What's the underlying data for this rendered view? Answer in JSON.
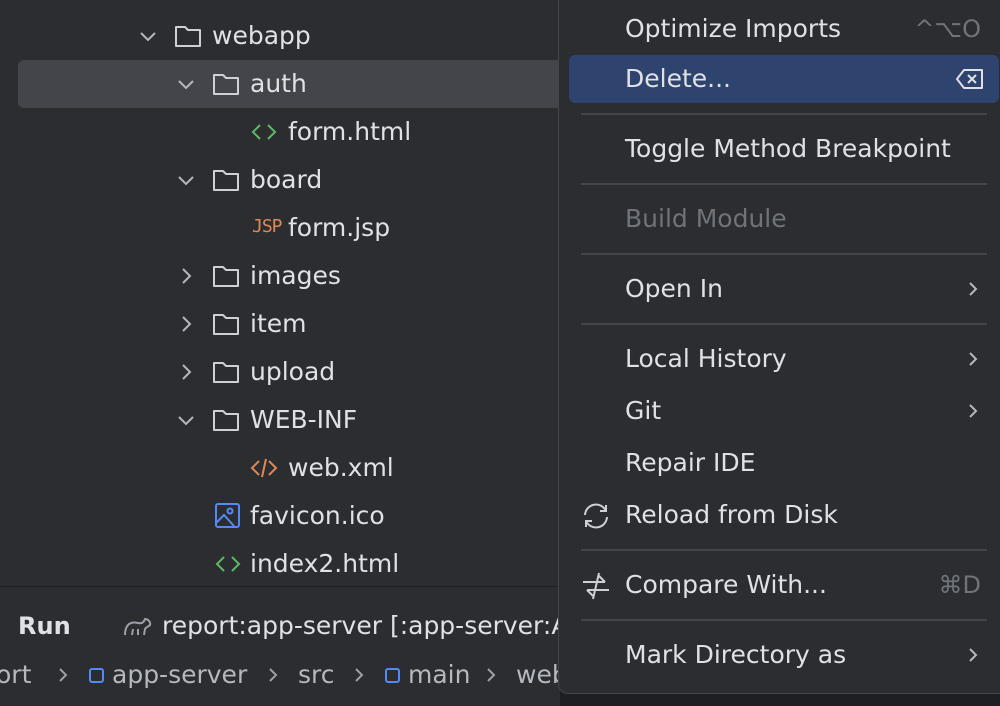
{
  "project_tree": {
    "items": [
      {
        "label": "webapp",
        "kind": "folder",
        "expanded": true
      },
      {
        "label": "auth",
        "kind": "folder",
        "expanded": true,
        "selected": true
      },
      {
        "label": "form.html",
        "kind": "html"
      },
      {
        "label": "board",
        "kind": "folder",
        "expanded": true
      },
      {
        "label": "form.jsp",
        "kind": "jsp",
        "badge": "JSP"
      },
      {
        "label": "images",
        "kind": "folder",
        "expanded": false
      },
      {
        "label": "item",
        "kind": "folder",
        "expanded": false
      },
      {
        "label": "upload",
        "kind": "folder",
        "expanded": false
      },
      {
        "label": "WEB-INF",
        "kind": "folder",
        "expanded": true
      },
      {
        "label": "web.xml",
        "kind": "xml"
      },
      {
        "label": "favicon.ico",
        "kind": "image"
      },
      {
        "label": "index2.html",
        "kind": "html"
      }
    ]
  },
  "run_panel": {
    "label": "Run",
    "config": "report:app-server [:app-server:A"
  },
  "breadcrumb": {
    "items": [
      "ort",
      "app-server",
      "src",
      "main",
      "web"
    ]
  },
  "context_menu": {
    "items": [
      {
        "label": "Optimize Imports",
        "shortcut": "^⌥O"
      },
      {
        "label": "Delete...",
        "icon": "delete-key-icon",
        "active": true
      },
      {
        "label": "Toggle Method Breakpoint"
      },
      {
        "label": "Build Module",
        "disabled": true
      },
      {
        "label": "Open In",
        "submenu": true
      },
      {
        "label": "Local History",
        "submenu": true
      },
      {
        "label": "Git",
        "submenu": true
      },
      {
        "label": "Repair IDE"
      },
      {
        "label": "Reload from Disk",
        "icon": "reload-icon"
      },
      {
        "label": "Compare With...",
        "icon": "compare-icon",
        "shortcut": "⌘D"
      },
      {
        "label": "Mark Directory as",
        "submenu": true
      }
    ]
  },
  "colors": {
    "panel_bg": "#2b2d30",
    "selection": "#43454a",
    "menu_active": "#2e436e",
    "html_icon": "#5fb865",
    "jsp_icon": "#e08855",
    "xml_icon": "#e08855",
    "image_icon": "#548af7"
  }
}
